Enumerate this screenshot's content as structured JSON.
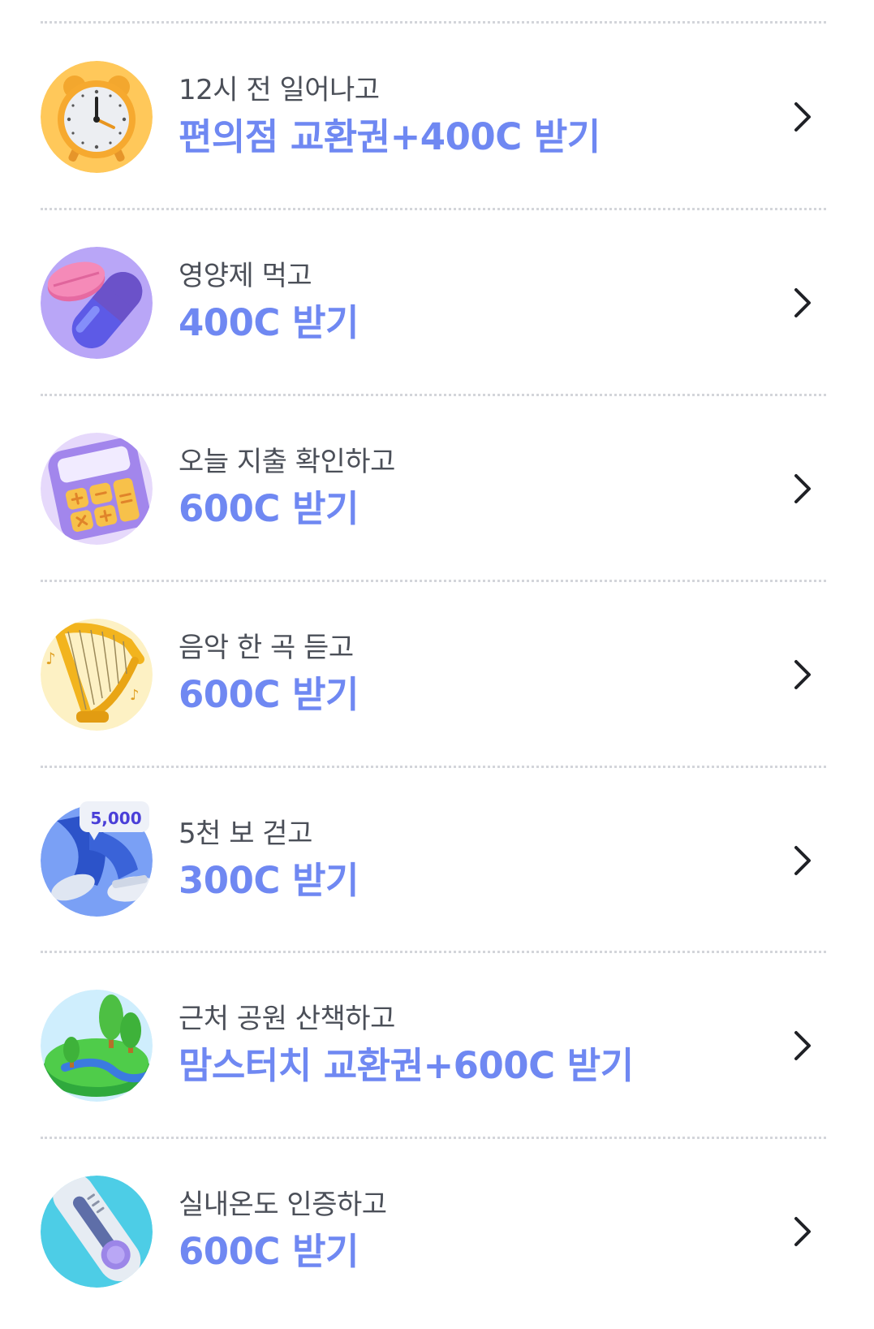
{
  "missions": [
    {
      "label": "12시 전 일어나고",
      "reward": "편의점 교환권+400C 받기",
      "icon": "alarm-clock-icon"
    },
    {
      "label": "영양제 먹고",
      "reward": "400C 받기",
      "icon": "pill-icon"
    },
    {
      "label": "오늘 지출 확인하고",
      "reward": "600C 받기",
      "icon": "calculator-icon"
    },
    {
      "label": "음악 한 곡 듣고",
      "reward": "600C 받기",
      "icon": "harp-icon"
    },
    {
      "label": "5천 보 걷고",
      "reward": "300C 받기",
      "icon": "walking-shoes-icon",
      "badge": "5,000"
    },
    {
      "label": "근처 공원 산책하고",
      "reward": "맘스터치 교환권+600C 받기",
      "icon": "park-icon"
    },
    {
      "label": "실내온도 인증하고",
      "reward": "600C 받기",
      "icon": "thermometer-icon"
    }
  ],
  "colors": {
    "reward": "#6f88f2",
    "label": "#4b4f58",
    "divider": "#d3d5da",
    "chevron": "#1f2126"
  }
}
